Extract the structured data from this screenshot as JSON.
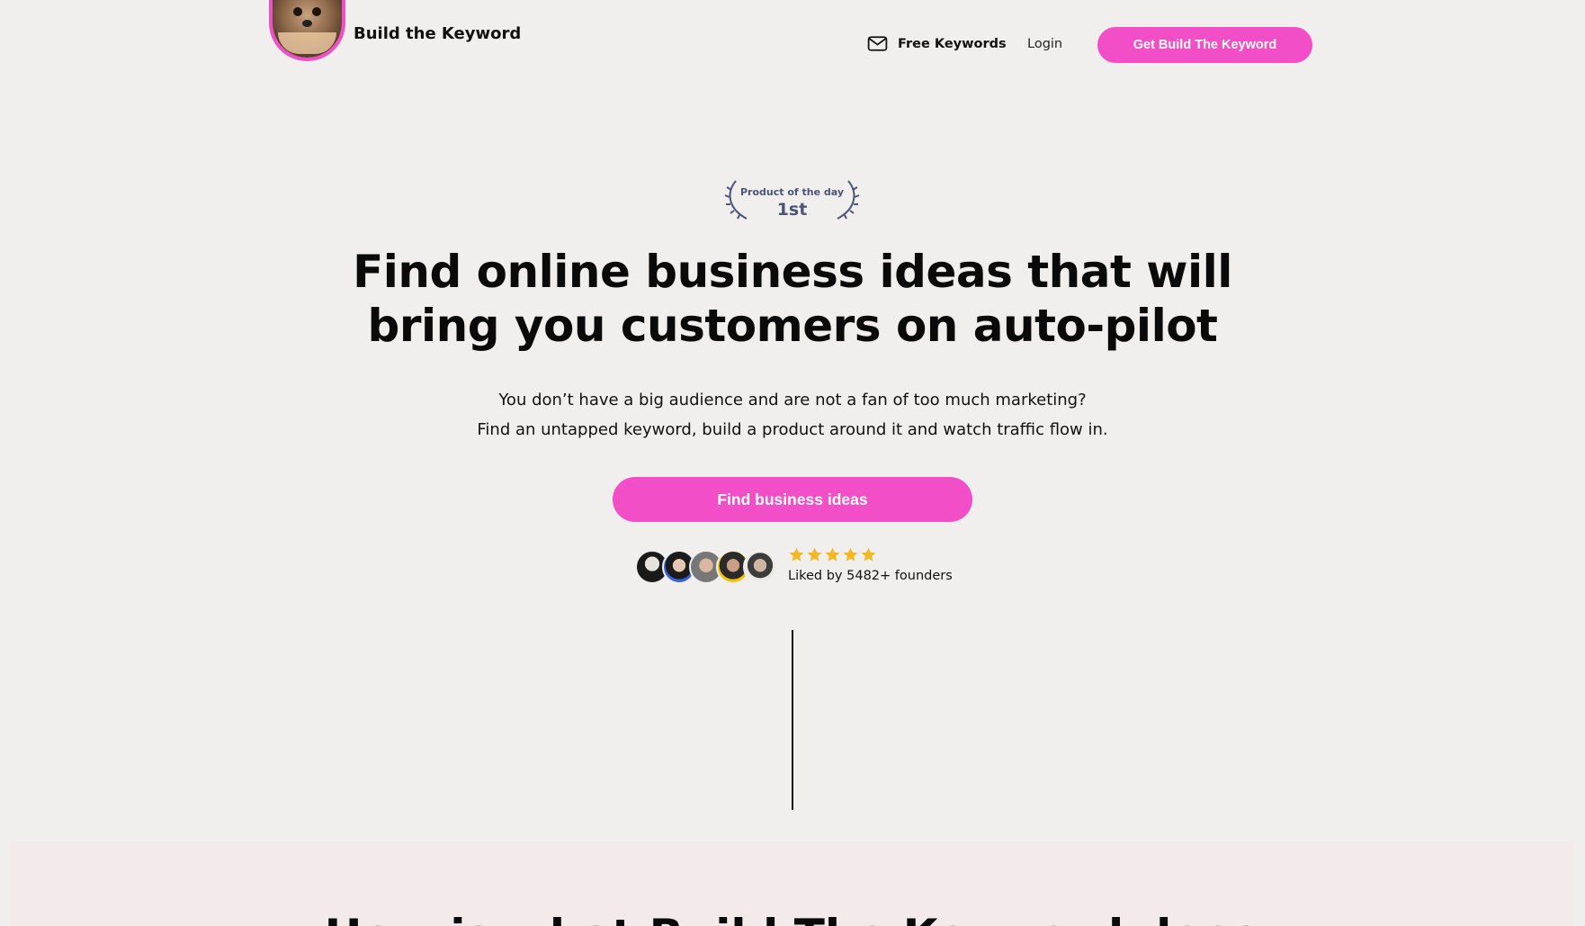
{
  "header": {
    "brand_name": "Build the Keyword",
    "nav_free_keywords": "Free Keywords",
    "nav_login": "Login",
    "cta_label": "Get Build The Keyword"
  },
  "badge": {
    "small": "Product of the day",
    "big": "1st"
  },
  "hero": {
    "title_line1": "Find online business ideas that will",
    "title_line2": "bring you customers on auto-pilot",
    "sub_line1": "You don’t have a big audience and are not a fan of too much marketing?",
    "sub_line2": "Find an untapped keyword, build a product around it and watch traffic flow in.",
    "cta_label": "Find business ideas"
  },
  "social_proof": {
    "rating_stars": 5,
    "liked_text": "Liked by 5482+ founders"
  },
  "next_section": {
    "title": "How is what Build The Keyword does"
  },
  "colors": {
    "accent": "#f24ec8",
    "background": "#f0efed",
    "badge": "#4b5578",
    "star": "#f5b722"
  },
  "icons": {
    "mail": "mail-icon",
    "laurel": "laurel-icon",
    "star": "star-icon"
  }
}
